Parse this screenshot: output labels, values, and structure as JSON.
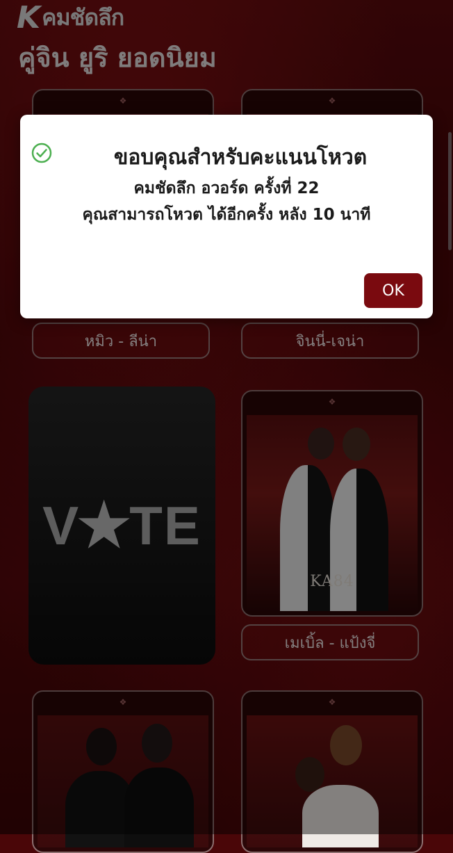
{
  "header": {
    "logo_k": "K",
    "logo_text": "คมชัดลึก",
    "title": "คู่จิน ยูริ ยอดนิยม"
  },
  "cards": [
    {
      "name": "หมิว - ลีน่า"
    },
    {
      "name": "จินนี่-เจน่า"
    },
    {
      "name": "เมเบิ้ล - แป้งจี่",
      "badge": "KA84"
    }
  ],
  "vote": {
    "text_v": "V",
    "star": "★",
    "text_te": "TE"
  },
  "dialog": {
    "title": "ขอบคุณสำหรับคะแนนโหวต",
    "line1": "คมชัดลึก อวอร์ด ครั้งที่ 22",
    "line2": "คุณสามารถโหวต ได้อีกครั้ง หลัง 10 นาที",
    "ok_label": "OK",
    "icon": "check-circle-icon",
    "icon_color": "#4caf50"
  },
  "colors": {
    "accent": "#7a0a0f",
    "background": "#4a0608"
  }
}
